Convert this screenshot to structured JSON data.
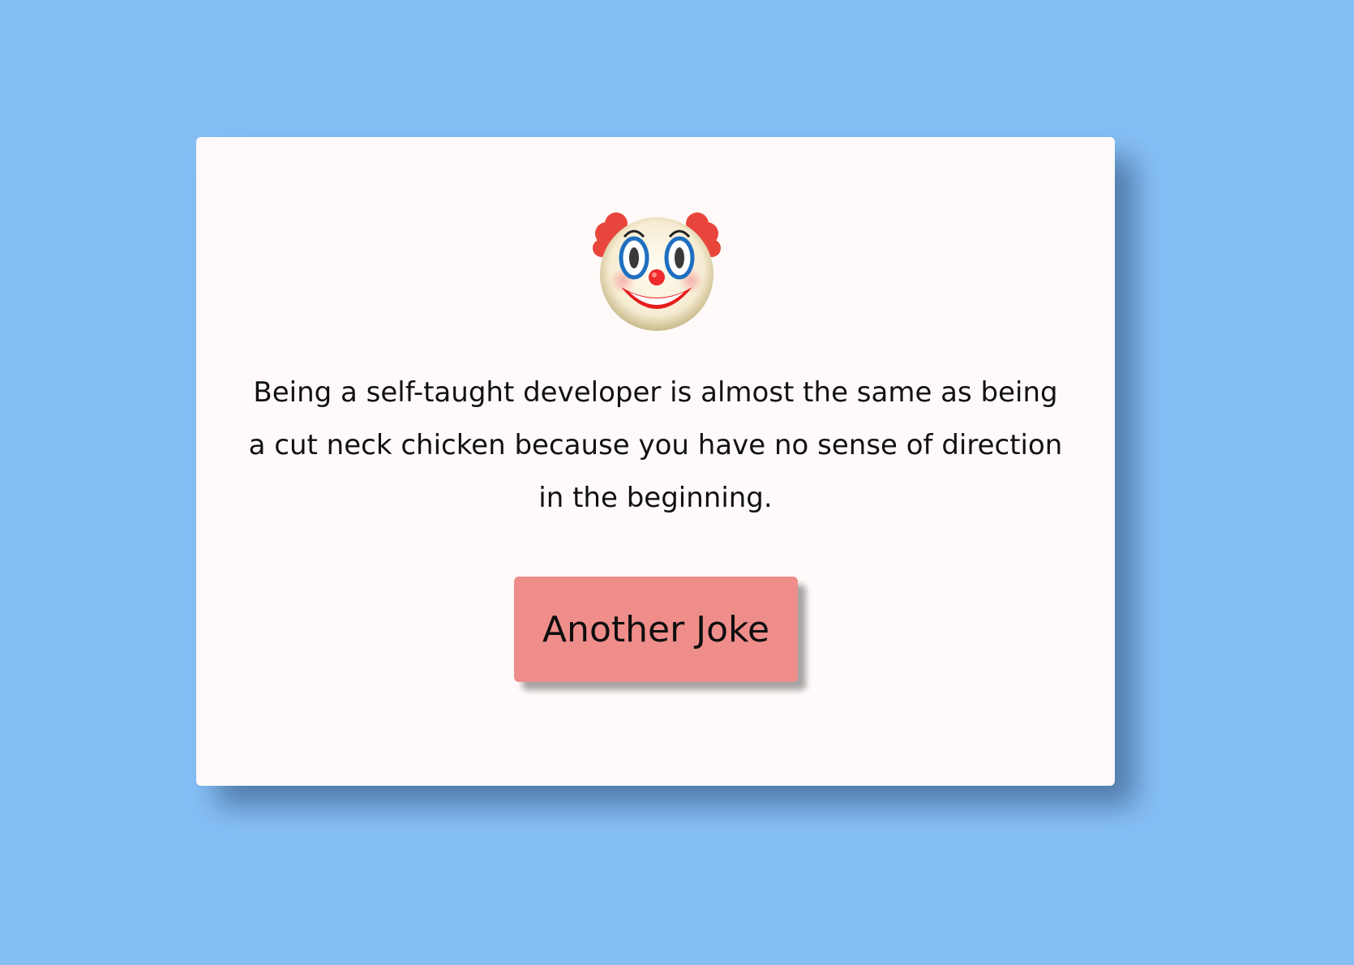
{
  "joke": {
    "emoji_icon": "clown-face-icon",
    "text": "Being a self-taught developer is almost the same as being a cut neck chicken because you have no sense of direction in the beginning."
  },
  "button": {
    "label": "Another Joke"
  },
  "colors": {
    "background": "#86bff6",
    "card": "#fffaf9",
    "button": "#ef8d8a"
  }
}
